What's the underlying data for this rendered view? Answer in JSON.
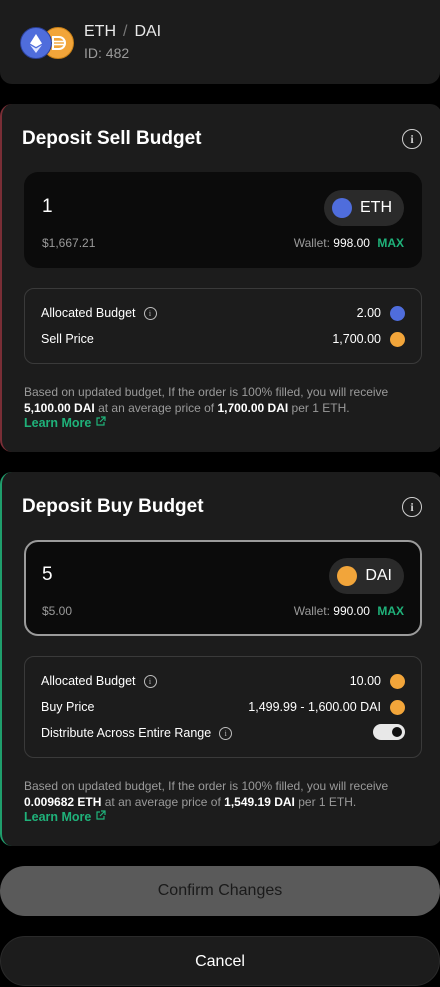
{
  "header": {
    "base": "ETH",
    "separator": "/",
    "quote": "DAI",
    "id_text": "ID: 482"
  },
  "sell": {
    "title": "Deposit Sell Budget",
    "amount": "1",
    "fiat": "$1,667.21",
    "wallet_label": "Wallet:",
    "wallet_value": "998.00",
    "max_label": "MAX",
    "token": "ETH",
    "allocated_label": "Allocated Budget",
    "allocated_value": "2.00",
    "price_label": "Sell Price",
    "price_value": "1,700.00",
    "note_1": "Based on updated budget, If the order is 100% filled, you will receive",
    "note_amount": "5,100.00 DAI",
    "note_2": "at an average price of",
    "note_price": "1,700.00 DAI",
    "note_3": "per 1 ETH.",
    "learn_more": "Learn More"
  },
  "buy": {
    "title": "Deposit Buy Budget",
    "amount": "5",
    "fiat": "$5.00",
    "wallet_label": "Wallet:",
    "wallet_value": "990.00",
    "max_label": "MAX",
    "token": "DAI",
    "allocated_label": "Allocated Budget",
    "allocated_value": "10.00",
    "price_label": "Buy Price",
    "price_value": "1,499.99 - 1,600.00 DAI",
    "distribute_label": "Distribute Across Entire Range",
    "distribute_on": true,
    "note_1": "Based on updated budget, If the order is 100% filled, you will receive",
    "note_amount": "0.009682 ETH",
    "note_2": "at an average price of",
    "note_price": "1,549.19 DAI",
    "note_3": "per 1 ETH.",
    "learn_more": "Learn More"
  },
  "actions": {
    "confirm": "Confirm Changes",
    "cancel": "Cancel"
  },
  "colors": {
    "accent_green": "#1fb27a",
    "sell_border": "#7a2e36",
    "buy_border": "#1f9e6c",
    "eth": "#4f6ddc",
    "dai": "#f2a53a"
  },
  "icons": [
    "eth-token-icon",
    "dai-token-icon",
    "info-icon",
    "external-link-icon",
    "toggle-switch"
  ]
}
